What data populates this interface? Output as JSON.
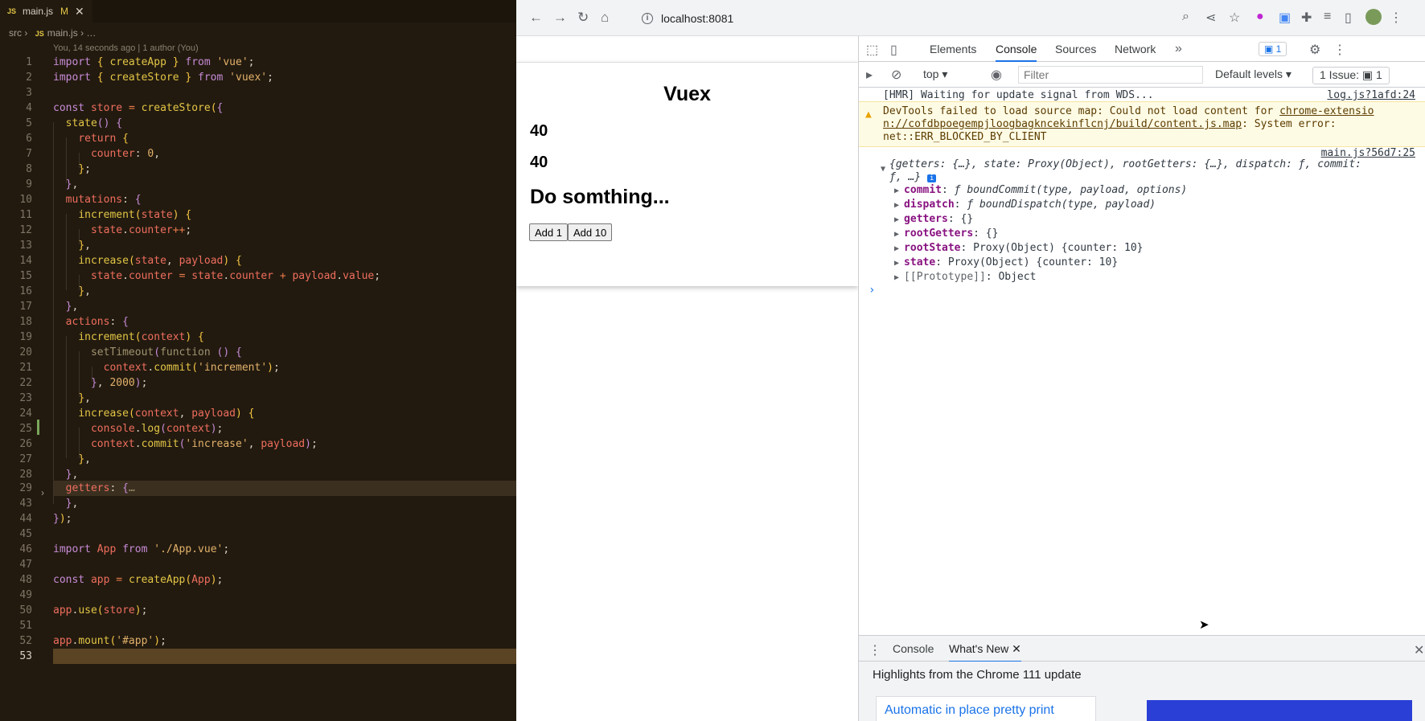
{
  "editor": {
    "tab_label": "main.js",
    "tab_icon": "JS",
    "tab_status": "M",
    "breadcrumb_folder": "src",
    "breadcrumb_file": "main.js",
    "breadcrumb_more": "…",
    "blame": "You, 14 seconds ago | 1 author (You)",
    "line_numbers": [
      "1",
      "2",
      "3",
      "4",
      "5",
      "6",
      "7",
      "8",
      "9",
      "10",
      "11",
      "12",
      "13",
      "14",
      "15",
      "16",
      "17",
      "18",
      "19",
      "20",
      "21",
      "22",
      "23",
      "24",
      "25",
      "26",
      "27",
      "28",
      "29",
      "43",
      "44",
      "45",
      "46",
      "47",
      "48",
      "49",
      "50",
      "51",
      "52",
      "53"
    ]
  },
  "browser": {
    "url": "localhost:8081",
    "page": {
      "title": "Vuex",
      "counter_1": "40",
      "counter_2": "40",
      "subtitle": "Do somthing...",
      "btn_add1": "Add 1",
      "btn_add10": "Add 10"
    }
  },
  "devtools": {
    "tabs": [
      "Elements",
      "Console",
      "Sources",
      "Network"
    ],
    "active_tab": "Console",
    "issue_count": "1",
    "context": "top",
    "filter_placeholder": "Filter",
    "levels": "Default levels",
    "issues_label": "1 Issue:",
    "issues_count": "1",
    "log1_text": "[HMR] Waiting for update signal from WDS...",
    "log1_src": "log.js?1afd:24",
    "warn_line1": "DevTools failed to load source map: Could not load content for ",
    "warn_link1": "chrome-extensio",
    "warn_link2": "n://cofdbpoegempjloogbagkncekinflcnj/build/content.js.map",
    "warn_line2_rest": ": System error:",
    "warn_line3": "net::ERR_BLOCKED_BY_CLIENT",
    "log2_src": "main.js?56d7:25",
    "obj_summary1": "{getters: {…}, state: Proxy(Object), rootGetters: {…}, dispatch: ƒ, commit:",
    "obj_summary2": "ƒ, …}",
    "props": [
      {
        "key": "commit",
        "val": "ƒ boundCommit(type, payload, options)"
      },
      {
        "key": "dispatch",
        "val": "ƒ boundDispatch(type, payload)"
      },
      {
        "key": "getters",
        "val": "{}"
      },
      {
        "key": "rootGetters",
        "val": "{}"
      },
      {
        "key": "rootState",
        "val": "Proxy(Object) {counter: 10}"
      },
      {
        "key": "state",
        "val": "Proxy(Object) {counter: 10}"
      },
      {
        "key": "[[Prototype]]",
        "val": "Object"
      }
    ],
    "drawer_tab1": "Console",
    "drawer_tab2": "What's New",
    "whatsnew_heading": "Highlights from the Chrome 111 update",
    "whatsnew_card": "Automatic in place pretty print"
  }
}
